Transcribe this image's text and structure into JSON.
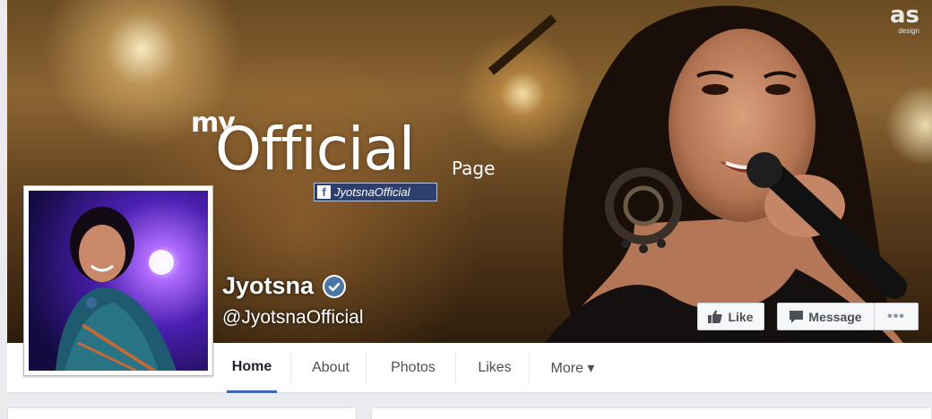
{
  "cover": {
    "my_text": "my",
    "official_text": "Official",
    "page_text": "Page",
    "fb_tag_text": "JyotsnaOfficial",
    "watermark_top": "as",
    "watermark_bottom": "design"
  },
  "profile": {
    "name": "Jyotsna",
    "handle": "@JyotsnaOfficial",
    "verified": true
  },
  "actions": {
    "like_label": "Like",
    "message_label": "Message",
    "more_label": "•••"
  },
  "tabs": [
    {
      "label": "Home",
      "active": true
    },
    {
      "label": "About",
      "active": false
    },
    {
      "label": "Photos",
      "active": false
    },
    {
      "label": "Likes",
      "active": false
    },
    {
      "label": "More ▾",
      "active": false
    }
  ],
  "colors": {
    "accent": "#4267b2",
    "verified_badge": "#4a76a8",
    "page_bg": "#e9ebee"
  }
}
